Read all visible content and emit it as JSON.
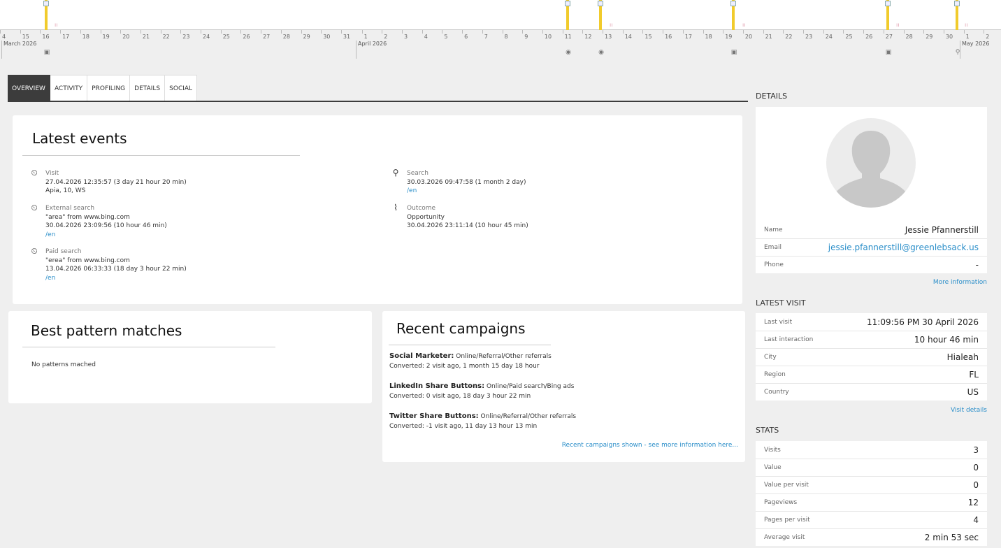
{
  "timeline": {
    "days": [
      "4",
      "15",
      "16",
      "17",
      "18",
      "19",
      "20",
      "21",
      "22",
      "23",
      "24",
      "25",
      "26",
      "27",
      "28",
      "29",
      "30",
      "31",
      "1",
      "2",
      "3",
      "4",
      "5",
      "6",
      "7",
      "8",
      "9",
      "10",
      "11",
      "12",
      "13",
      "14",
      "15",
      "16",
      "17",
      "18",
      "19",
      "20",
      "21",
      "22",
      "23",
      "24",
      "25",
      "26",
      "27",
      "28",
      "29",
      "30",
      "1",
      "2"
    ],
    "months": [
      "March 2026",
      "April 2026",
      "May 2026"
    ]
  },
  "tabs": [
    "OVERVIEW",
    "ACTIVITY",
    "PROFILING",
    "DETAILS",
    "SOCIAL"
  ],
  "latest_events": {
    "title": "Latest events",
    "left": [
      {
        "icon": "calendar-clock-icon",
        "label": "Visit",
        "lines": [
          "27.04.2026 12:35:57 (3 day 21 hour 20 min)",
          "Apia, 10, WS"
        ],
        "link": ""
      },
      {
        "icon": "calendar-clock-icon",
        "label": "External search",
        "lines": [
          "\"area\" from www.bing.com",
          "30.04.2026 23:09:56 (10 hour 46 min)"
        ],
        "link": "/en"
      },
      {
        "icon": "calendar-clock-icon",
        "label": "Paid search",
        "lines": [
          "\"erea\" from www.bing.com",
          "13.04.2026 06:33:33 (18 day 3 hour 22 min)"
        ],
        "link": "/en"
      }
    ],
    "right": [
      {
        "icon": "search-icon",
        "label": "Search",
        "lines": [
          "30.03.2026 09:47:58 (1 month 2 day)"
        ],
        "link": "/en"
      },
      {
        "icon": "chart-icon",
        "label": "Outcome",
        "lines": [
          "Opportunity",
          "30.04.2026 23:11:14 (10 hour 45 min)"
        ],
        "link": ""
      }
    ]
  },
  "patterns": {
    "title": "Best pattern matches",
    "empty": "No patterns mached"
  },
  "campaigns": {
    "title": "Recent campaigns",
    "items": [
      {
        "name": "Social Marketer:",
        "channel": "Online/Referral/Other referrals",
        "converted": "Converted: 2 visit ago, 1 month 15 day 18 hour"
      },
      {
        "name": "LinkedIn Share Buttons:",
        "channel": "Online/Paid search/Bing ads",
        "converted": "Converted: 0 visit ago, 18 day 3 hour 22 min"
      },
      {
        "name": "Twitter Share Buttons:",
        "channel": "Online/Referral/Other referrals",
        "converted": "Converted: -1 visit ago, 11 day 13 hour 13 min"
      }
    ],
    "more": "Recent campaigns shown - see more information here..."
  },
  "details": {
    "title": "DETAILS",
    "rows": [
      {
        "k": "Name",
        "v": "Jessie Pfannerstill",
        "link": false
      },
      {
        "k": "Email",
        "v": "jessie.pfannerstill@greenlebsack.us",
        "link": true
      },
      {
        "k": "Phone",
        "v": "-",
        "link": false
      }
    ],
    "more": "More information"
  },
  "latest_visit": {
    "title": "LATEST VISIT",
    "rows": [
      {
        "k": "Last visit",
        "v": "11:09:56 PM 30 April 2026"
      },
      {
        "k": "Last interaction",
        "v": "10 hour 46 min"
      },
      {
        "k": "City",
        "v": "Hialeah"
      },
      {
        "k": "Region",
        "v": "FL"
      },
      {
        "k": "Country",
        "v": "US"
      }
    ],
    "more": "Visit details"
  },
  "stats": {
    "title": "STATS",
    "rows": [
      {
        "k": "Visits",
        "v": "3"
      },
      {
        "k": "Value",
        "v": "0"
      },
      {
        "k": "Value per visit",
        "v": "0"
      },
      {
        "k": "Pageviews",
        "v": "12"
      },
      {
        "k": "Pages per visit",
        "v": "4"
      },
      {
        "k": "Average visit",
        "v": "2 min 53 sec"
      }
    ]
  },
  "colors": {
    "accent": "#2a8ec9",
    "tab_active": "#3c3c3c",
    "marker": "#f1cb2c"
  }
}
